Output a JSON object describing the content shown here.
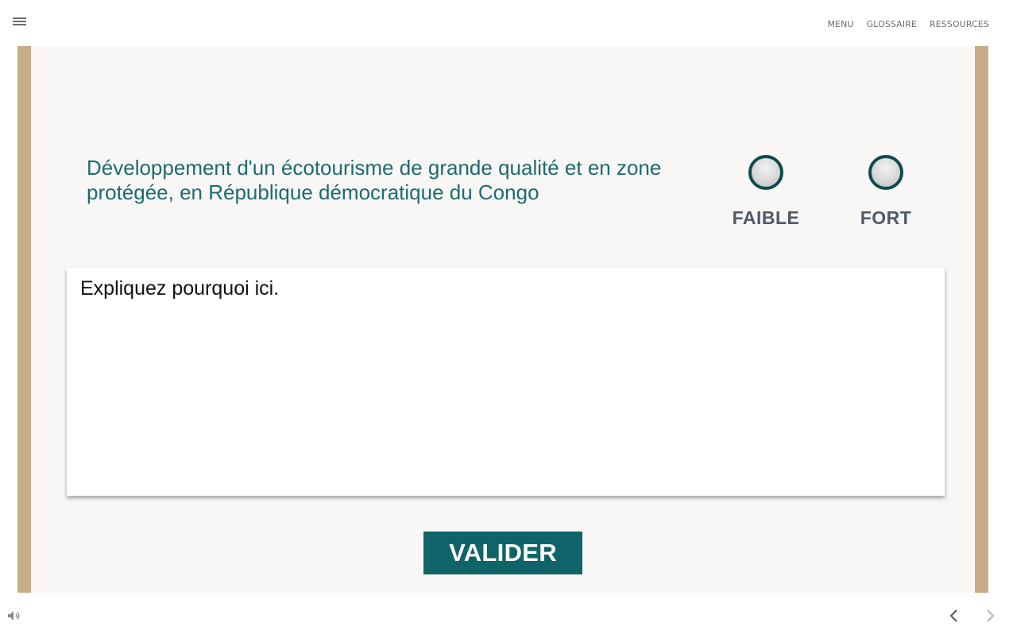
{
  "header": {
    "menu_icon": "hamburger-icon",
    "nav": [
      "MENU",
      "GLOSSAIRE",
      "RESSOURCES"
    ]
  },
  "question": {
    "text": "Développement d'un écotourisme de grande qualité et en zone protégée, en République démocratique du Congo"
  },
  "choices": [
    {
      "label": "FAIBLE",
      "selected": false
    },
    {
      "label": "FORT",
      "selected": false
    }
  ],
  "answer": {
    "placeholder": "Expliquez pourquoi ici.",
    "value": ""
  },
  "submit": {
    "label": "VALIDER"
  },
  "footer": {
    "sound_icon": "speaker-icon",
    "prev_icon": "chevron-left-icon",
    "next_icon": "chevron-right-icon"
  },
  "colors": {
    "frame": "#c6ad89",
    "stage": "#f8f7f6",
    "accent": "#0e6468",
    "question_text": "#1d6b6e",
    "radio_border": "#0f4a4d",
    "choice_label": "#4d5b6b"
  }
}
